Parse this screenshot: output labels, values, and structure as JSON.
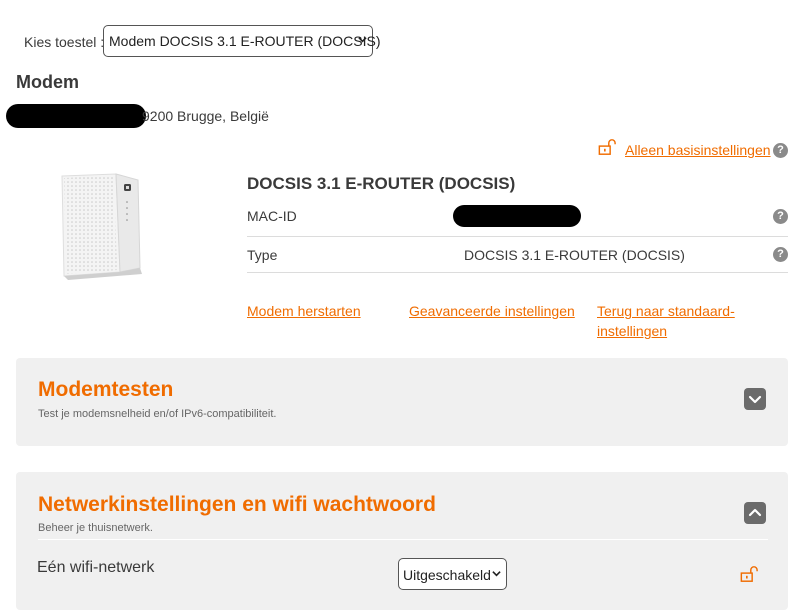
{
  "device_selector": {
    "label": "Kies toestel :",
    "selected": "Modem DOCSIS 3.1 E-ROUTER (DOCSIS)"
  },
  "modem": {
    "title": "Modem",
    "address_visible": "9200 Brugge, België"
  },
  "basic_settings_link": "Alleen basisinstellingen",
  "device": {
    "title": "DOCSIS 3.1 E-ROUTER (DOCSIS)",
    "mac_label": "MAC-ID",
    "type_label": "Type",
    "type_value": "DOCSIS 3.1 E-ROUTER (DOCSIS)",
    "help_glyph": "?"
  },
  "actions": {
    "restart": "Modem herstarten",
    "advanced": "Geavanceerde instellingen",
    "reset": "Terug naar standaard-instellingen"
  },
  "panels": {
    "tests": {
      "title": "Modemtesten",
      "subtitle": "Test je modemsnelheid en/of IPv6-compatibiliteit.",
      "state": "collapsed"
    },
    "network": {
      "title": "Netwerkinstellingen en wifi wachtwoord",
      "subtitle": "Beheer je thuisnetwerk.",
      "state": "expanded",
      "wifi_label": "Eén wifi-netwerk",
      "wifi_value": "Uitgeschakeld"
    }
  },
  "colors": {
    "accent": "#f06c00",
    "panel_bg": "#f0f0f0",
    "help_icon": "#8a8a8a",
    "toggle_bg": "#6b6b6b"
  },
  "icons": {
    "lock": "unlocked-lock-icon",
    "help": "help-icon",
    "chevron_down": "chevron-down-icon",
    "chevron_up": "chevron-up-icon",
    "router": "router-image"
  }
}
